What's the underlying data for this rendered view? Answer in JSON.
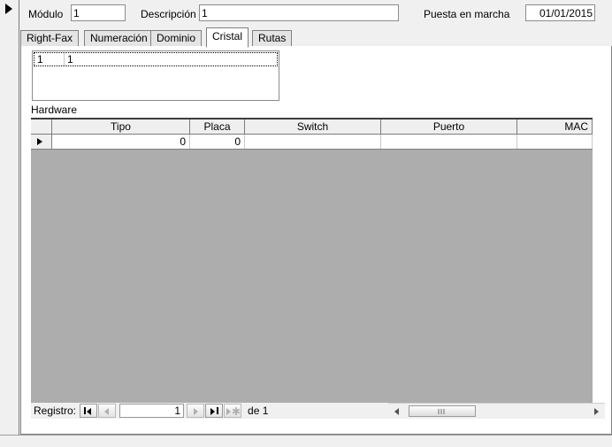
{
  "form": {
    "record_selector_icon": "right-triangle-icon",
    "fields": {
      "modulo_label": "Módulo",
      "modulo_value": "1",
      "descripcion_label": "Descripción",
      "descripcion_value": "1",
      "puesta_label": "Puesta en marcha",
      "puesta_value": "01/01/2015"
    }
  },
  "tabs": [
    {
      "label": "Right-Fax",
      "active": false
    },
    {
      "label": "Numeración",
      "active": false
    },
    {
      "label": "Dominio",
      "active": false
    },
    {
      "label": "Cristal",
      "active": true
    },
    {
      "label": "Rutas",
      "active": false
    }
  ],
  "listbox": {
    "selected_row": [
      "1",
      "1"
    ]
  },
  "section": {
    "hardware_label": "Hardware"
  },
  "grid": {
    "columns": [
      "Tipo",
      "Placa",
      "Switch",
      "Puerto",
      "MAC"
    ],
    "rows": [
      {
        "selector_icon": "right-triangle-icon",
        "Tipo": "0",
        "Placa": "0",
        "Switch": "",
        "Puerto": "",
        "MAC": ""
      }
    ]
  },
  "navigator": {
    "label": "Registro:",
    "first_icon": "first-record-icon",
    "prev_icon": "previous-record-icon",
    "current": "1",
    "next_icon": "next-record-icon",
    "last_icon": "last-record-icon",
    "new_icon": "new-record-icon",
    "of_text": "de  1"
  },
  "scrollbar": {
    "left_icon": "scroll-left-arrow-icon",
    "right_icon": "scroll-right-arrow-icon",
    "grip_icon": "scroll-thumb-grip-icon"
  },
  "colors": {
    "form_background": "#f0f0f0",
    "page_background": "#ffffff",
    "grid_empty_background": "#adadad",
    "grid_header_background": "#efefef",
    "border": "#808080"
  }
}
